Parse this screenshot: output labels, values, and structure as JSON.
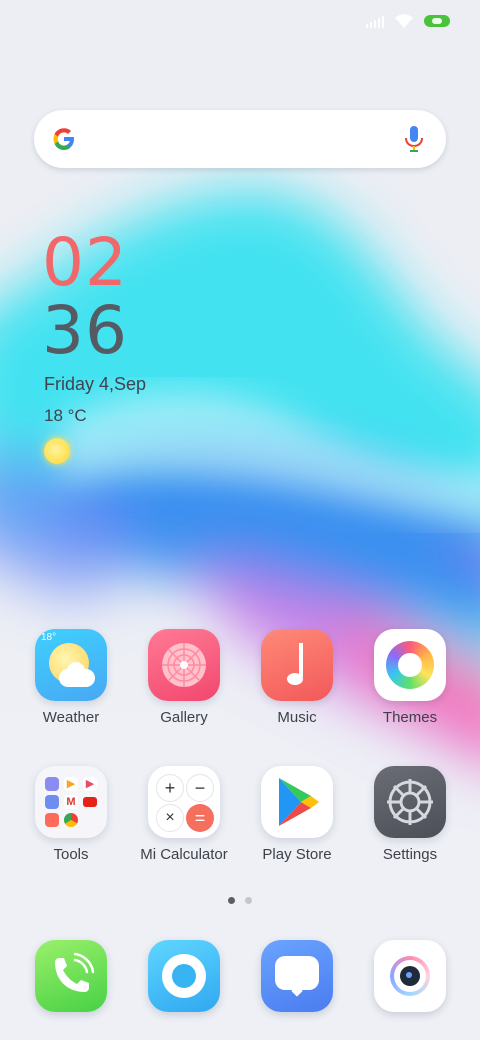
{
  "status_bar": {
    "signal_icon": "cell-signal-icon",
    "wifi_icon": "wifi-icon",
    "battery_icon": "battery-charging-icon",
    "battery_color": "#49c33a"
  },
  "search_bar": {
    "logo_icon": "google-g-icon",
    "voice_icon": "microphone-icon"
  },
  "clock_widget": {
    "hour": "02",
    "minute": "36",
    "date": "Friday 4,Sep",
    "temperature": "18 °C",
    "weather_icon": "sun-icon",
    "hour_color": "#f0686a",
    "minute_color": "#555a63"
  },
  "apps": [
    {
      "label": "Weather",
      "icon": "weather-icon",
      "badge": "18°"
    },
    {
      "label": "Gallery",
      "icon": "gallery-flower-icon"
    },
    {
      "label": "Music",
      "icon": "music-note-icon"
    },
    {
      "label": "Themes",
      "icon": "themes-ring-icon"
    },
    {
      "label": "Tools",
      "icon": "tools-folder-icon"
    },
    {
      "label": "Mi Calculator",
      "icon": "calculator-icon"
    },
    {
      "label": "Play Store",
      "icon": "play-store-icon"
    },
    {
      "label": "Settings",
      "icon": "settings-gear-icon"
    }
  ],
  "page_indicator": {
    "pages": 2,
    "active_page": 1
  },
  "dock": [
    {
      "icon": "phone-icon"
    },
    {
      "icon": "browser-icon"
    },
    {
      "icon": "messages-icon"
    },
    {
      "icon": "camera-icon"
    }
  ]
}
